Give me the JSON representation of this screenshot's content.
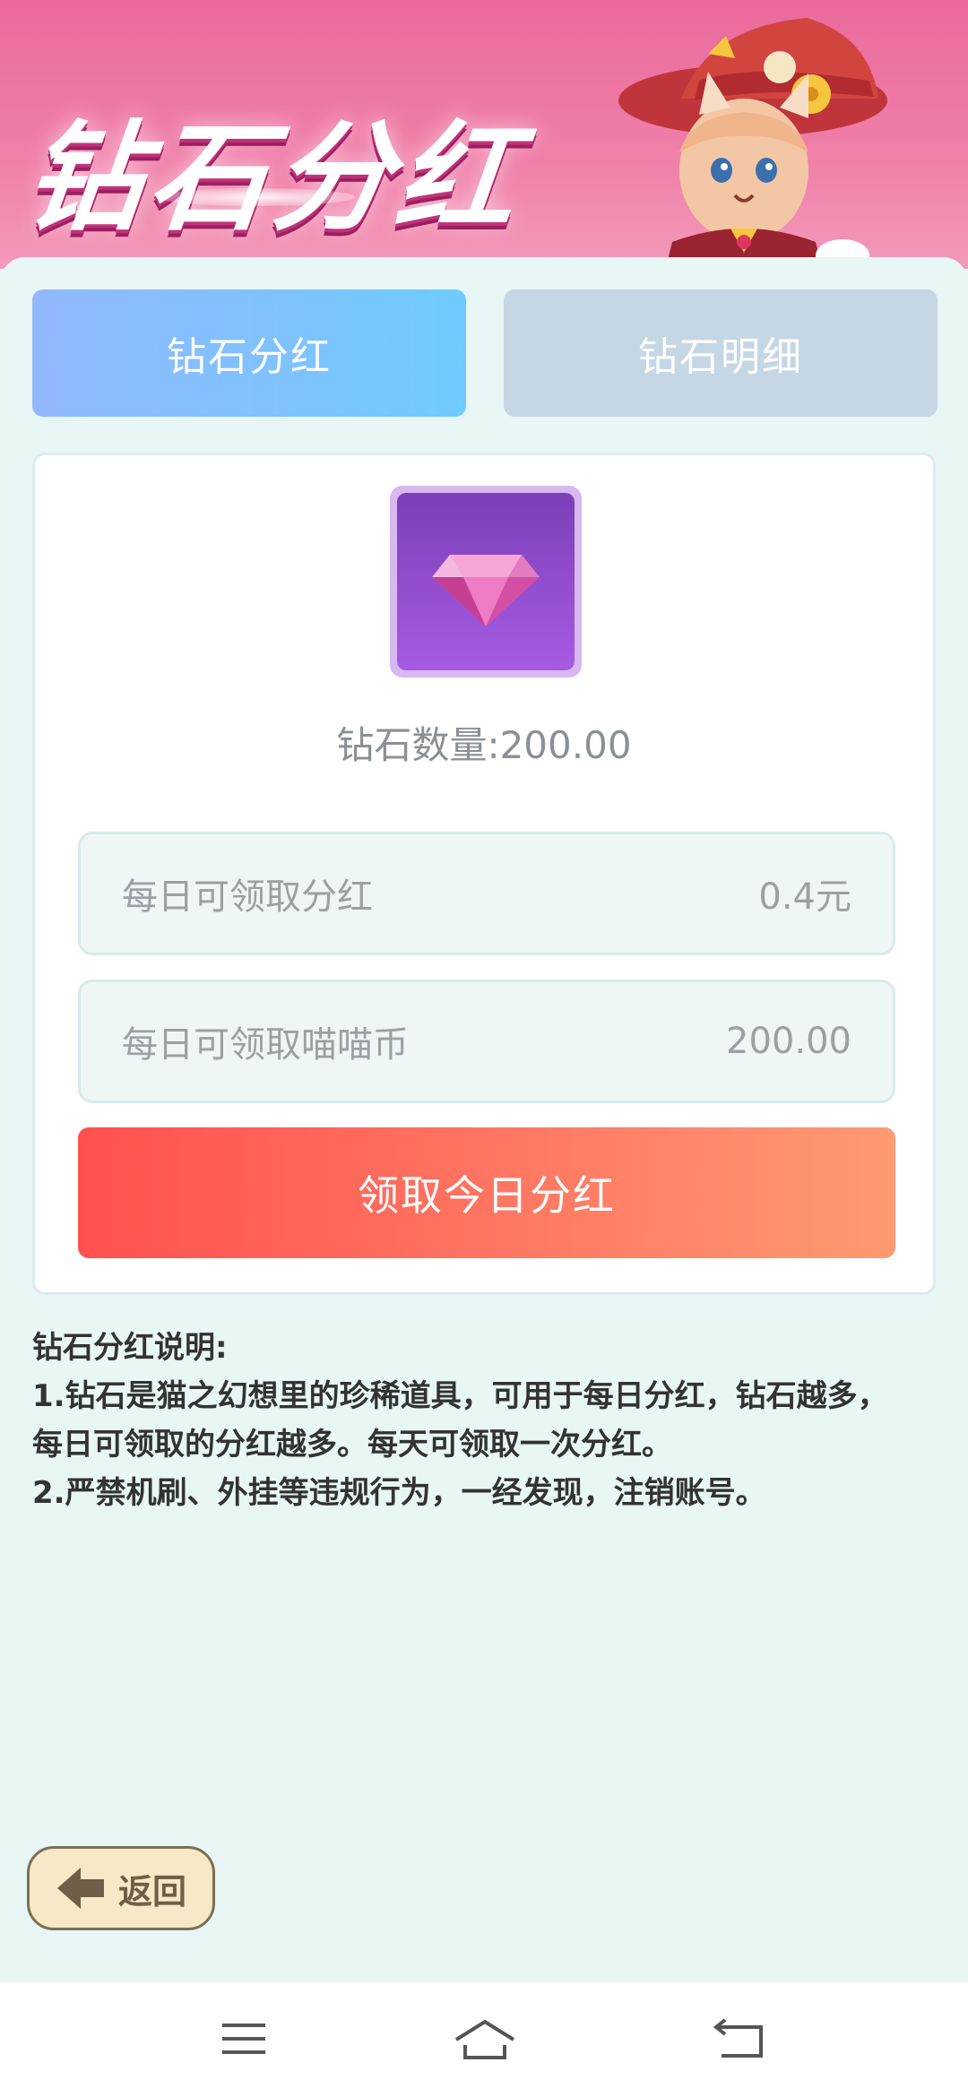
{
  "banner": {
    "title": "钻石分红"
  },
  "tabs": [
    {
      "label": "钻石分红",
      "active": true
    },
    {
      "label": "钻石明细",
      "active": false
    }
  ],
  "card": {
    "gem_count_text": "钻石数量:200.00",
    "rows": [
      {
        "label": "每日可领取分红",
        "value": "0.4元"
      },
      {
        "label": "每日可领取喵喵币",
        "value": "200.00"
      }
    ],
    "claim_button": "领取今日分红"
  },
  "description": {
    "title": "钻石分红说明:",
    "lines": [
      "1.钻石是猫之幻想里的珍稀道具，可用于每日分红，钻石越多，",
      "每日可领取的分红越多。每天可领取一次分红。",
      "2.严禁机刷、外挂等违规行为，一经发现，注销账号。"
    ]
  },
  "back_button": {
    "label": "返回"
  },
  "colors": {
    "banner": "#ea6a9c",
    "tab_active": "#6fcbff",
    "tab_inactive": "#c5d7e4",
    "claim_start": "#ff5050",
    "claim_end": "#ff9a72",
    "background": "#e8f6f6"
  },
  "icons": {
    "gem": "diamond-icon",
    "back": "arrow-left-icon",
    "nav": [
      "menu-icon",
      "home-icon",
      "back-nav-icon"
    ]
  }
}
